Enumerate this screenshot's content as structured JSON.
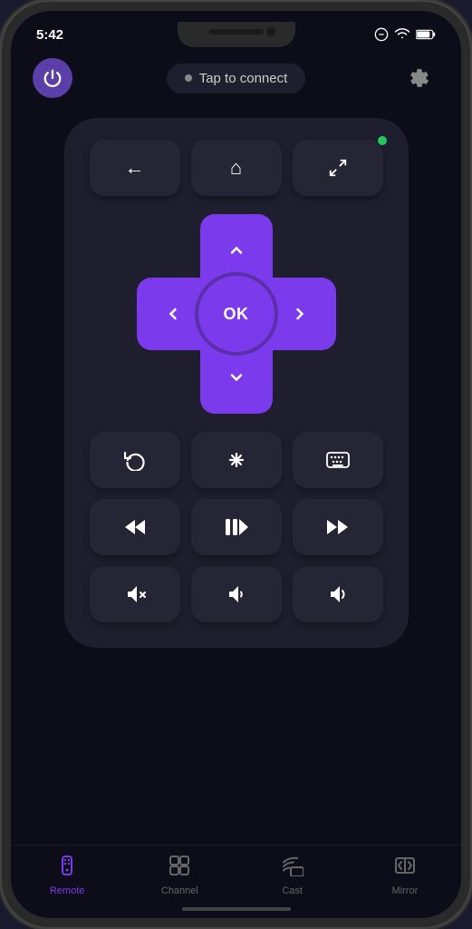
{
  "status_bar": {
    "time": "5:42"
  },
  "header": {
    "connect_text": "Tap to connect",
    "connect_dot_color": "#888888"
  },
  "remote": {
    "status_dot_color": "#22c55e",
    "top_buttons": [
      {
        "label": "←",
        "aria": "back"
      },
      {
        "label": "⌂",
        "aria": "home"
      },
      {
        "label": "⤢",
        "aria": "fullscreen"
      }
    ],
    "dpad": {
      "ok_label": "OK",
      "up_label": "∧",
      "down_label": "∨",
      "left_label": "<",
      "right_label": ">"
    },
    "middle_buttons": [
      {
        "label": "↺",
        "aria": "replay"
      },
      {
        "label": "✱",
        "aria": "asterisk"
      },
      {
        "label": "⌨",
        "aria": "keyboard"
      }
    ],
    "media_buttons": [
      {
        "label": "«",
        "aria": "rewind"
      },
      {
        "label": "⏯",
        "aria": "play-pause"
      },
      {
        "label": "»",
        "aria": "fast-forward"
      }
    ],
    "volume_buttons": [
      {
        "label": "🔇",
        "aria": "mute"
      },
      {
        "label": "🔉",
        "aria": "volume-down"
      },
      {
        "label": "🔊",
        "aria": "volume-up"
      }
    ]
  },
  "tabs": [
    {
      "id": "remote",
      "label": "Remote",
      "icon": "remote",
      "active": true
    },
    {
      "id": "channel",
      "label": "Channel",
      "icon": "channel",
      "active": false
    },
    {
      "id": "cast",
      "label": "Cast",
      "icon": "cast",
      "active": false
    },
    {
      "id": "mirror",
      "label": "Mirror",
      "icon": "mirror",
      "active": false
    }
  ]
}
